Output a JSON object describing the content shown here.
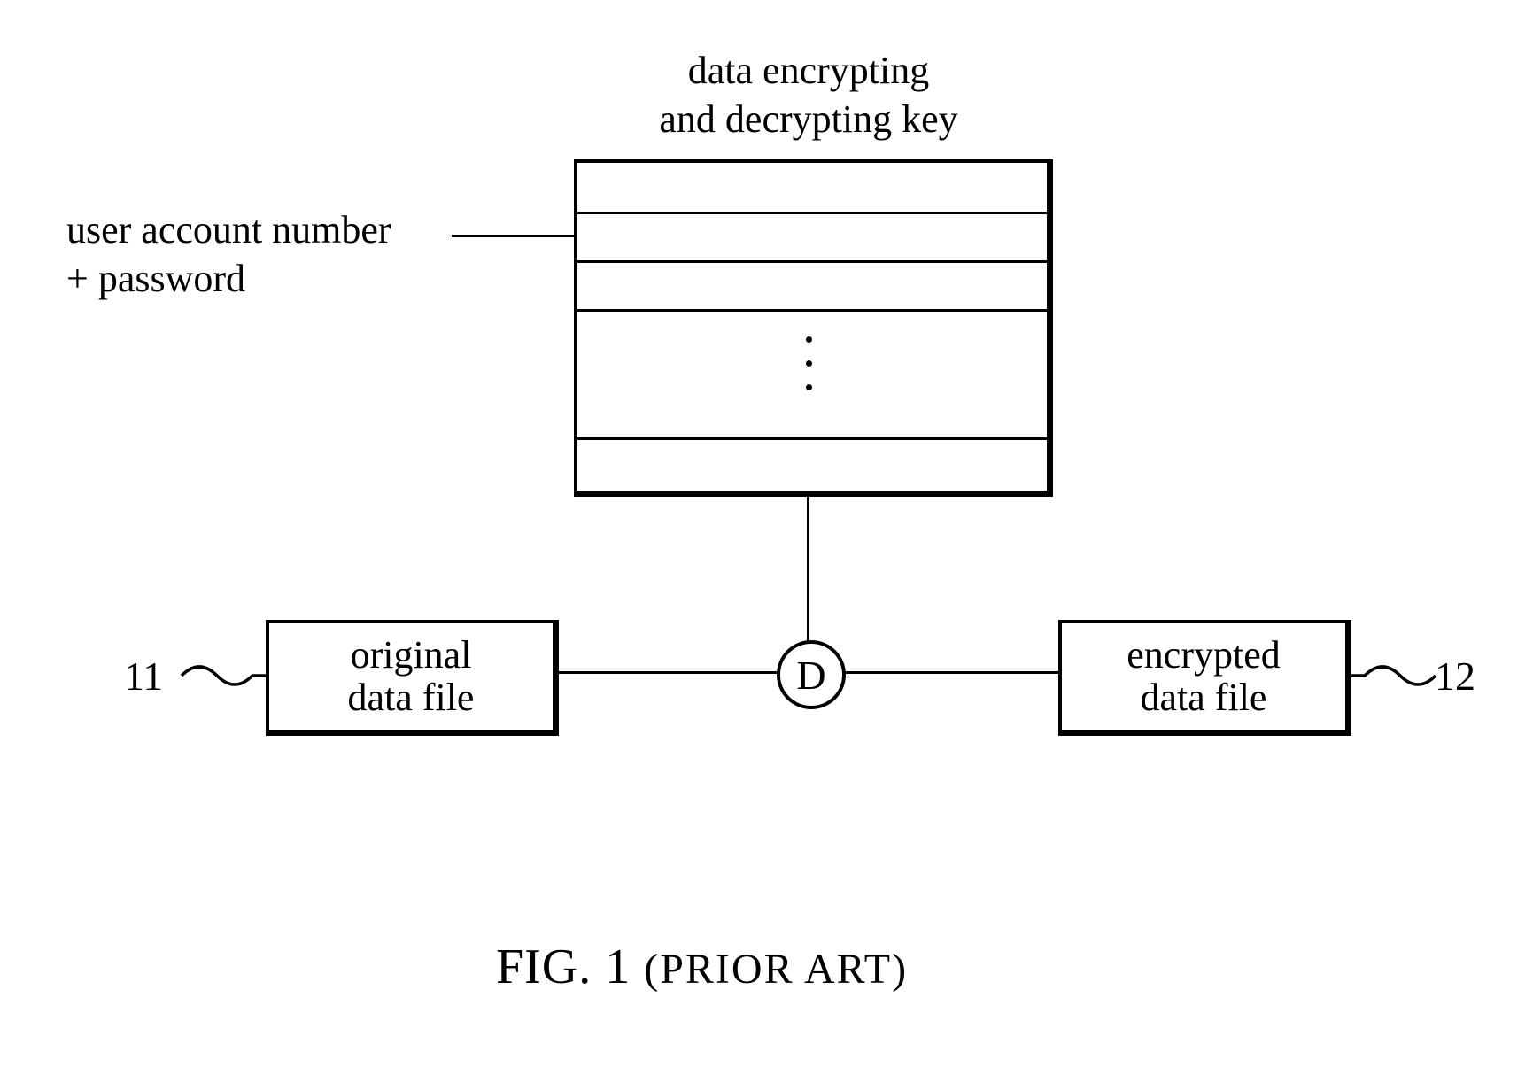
{
  "title": {
    "line1": "data encrypting",
    "line2": "and decrypting key"
  },
  "user_label": {
    "line1": "user account number",
    "line2": "+ password"
  },
  "left_file": {
    "line1": "original",
    "line2": "data file",
    "ref": "11"
  },
  "right_file": {
    "line1": "encrypted",
    "line2": "data file",
    "ref": "12"
  },
  "d_label": "D",
  "fig": {
    "main": "FIG. 1",
    "sub": "(PRIOR ART)"
  }
}
